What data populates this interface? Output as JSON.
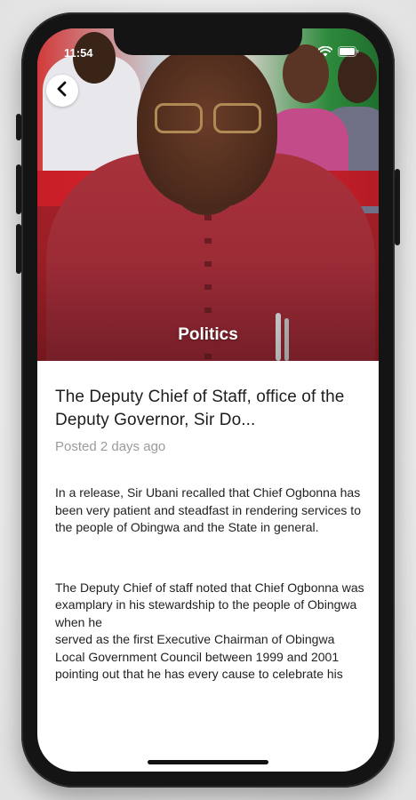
{
  "status_bar": {
    "time": "11:54"
  },
  "icons": {
    "back": "chevron-left-icon",
    "wifi": "wifi-icon",
    "battery": "battery-icon"
  },
  "hero": {
    "category": "Politics"
  },
  "article": {
    "headline": "The Deputy Chief of Staff, office of the Deputy Governor, Sir Do...",
    "posted": "Posted 2 days ago",
    "paragraphs": [
      "  In a release, Sir Ubani recalled that Chief Ogbonna has been very patient and steadfast in rendering services to the people of Obingwa and the State in general.",
      "The Deputy Chief of staff noted that Chief Ogbonna was examplary in his stewardship to the people of Obingwa when he\nserved as the first Executive Chairman of Obingwa Local Government Council between 1999 and 2001 pointing out that he has every cause to celebrate his"
    ]
  },
  "colors": {
    "accent_text": "#ffffff",
    "muted_text": "#9b9b9b",
    "shirt": "#a8323c"
  }
}
